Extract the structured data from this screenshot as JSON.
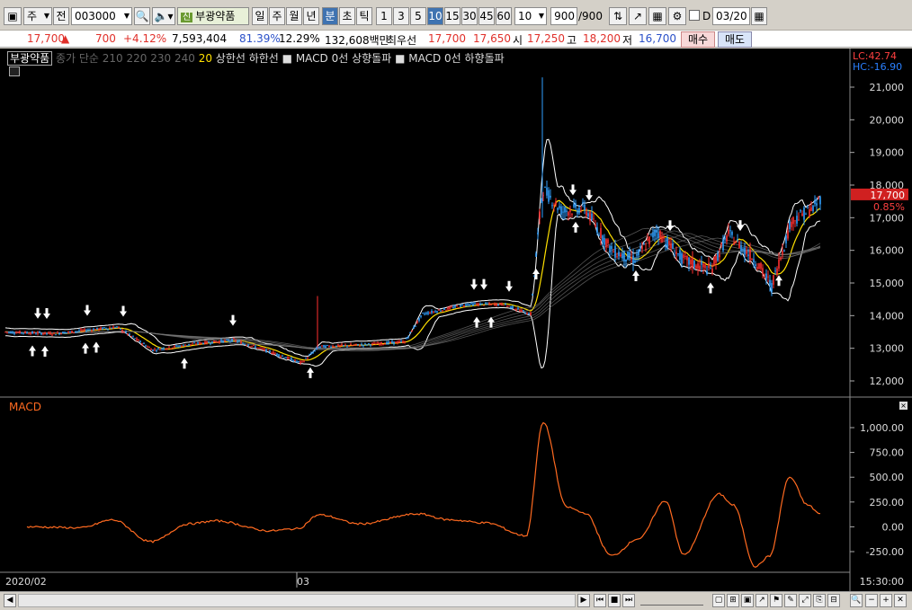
{
  "toolbar": {
    "period_type": "주",
    "prev_label": "전",
    "code": "003000",
    "tag": "신",
    "stock_name": "부광약품",
    "intervals": [
      "일",
      "주",
      "월",
      "년",
      "분",
      "초",
      "틱"
    ],
    "active_interval": "분",
    "minutes": [
      "1",
      "3",
      "5",
      "10",
      "15",
      "30",
      "45",
      "60"
    ],
    "active_minute": "10",
    "count_select": "10",
    "count_value": "900",
    "count_total": "/900",
    "d_label": "D",
    "date": "03/20"
  },
  "quote": {
    "price": "17,700",
    "change": "700",
    "change_pct": "+4.12%",
    "volume": "7,593,404",
    "vol_ratio": "81.39%",
    "turnover": "12.29%",
    "amount": "132,608백만",
    "best_label": "최우선",
    "ask": "17,700",
    "bid": "17,650",
    "open_label": "시",
    "open": "17,250",
    "high_label": "고",
    "high": "18,200",
    "low_label": "저",
    "low": "16,700",
    "buy_label": "매수",
    "sell_label": "매도"
  },
  "legend": {
    "name": "부광약품",
    "gray_text": "종가 단순 210  220  230  240",
    "yellow_text": "20",
    "rest": "상한선  하한선  ■ MACD 0선 상향돌파  ■ MACD 0선 하향돌파"
  },
  "price_axis": {
    "lc": "LC:42.74",
    "hc": "HC:-16.90",
    "ticks": [
      "21,000",
      "20,000",
      "19,000",
      "18,000",
      "17,000",
      "16,000",
      "15,000",
      "14,000",
      "13,000",
      "12,000"
    ],
    "current": "17,700",
    "current_pct": "0.85%"
  },
  "macd_panel": {
    "label": "MACD",
    "ticks": [
      "1,000.00",
      "750.00",
      "500.00",
      "250.00",
      "0.00",
      "-250.00"
    ]
  },
  "x_axis": {
    "labels": [
      "2020/02",
      "03"
    ],
    "time": "15:30:00"
  },
  "colors": {
    "candle_up": "#ff3030",
    "candle_down": "#30a0ff",
    "ma20": "#ffe000",
    "band": "#ffffff",
    "macd": "#ff6a20"
  }
}
